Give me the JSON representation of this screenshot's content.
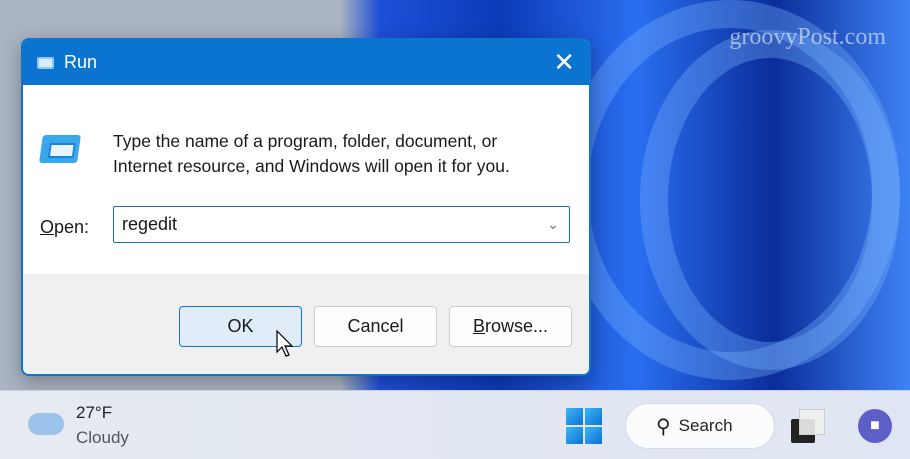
{
  "watermark": "groovyPost.com",
  "dialog": {
    "title": "Run",
    "close": "✕",
    "description_line1": "Type the name of a program, folder, document, or",
    "description_line2": "Internet resource, and Windows will open it for you.",
    "open_label_first": "O",
    "open_label_rest": "pen:",
    "open_value": "regedit",
    "buttons": {
      "ok": "OK",
      "cancel": "Cancel",
      "browse_first": "B",
      "browse_rest": "rowse..."
    }
  },
  "taskbar": {
    "weather": {
      "temp": "27°F",
      "condition": "Cloudy"
    },
    "search_label": "Search"
  }
}
